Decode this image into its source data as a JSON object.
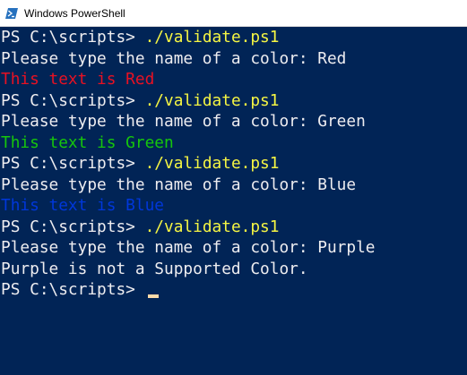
{
  "window": {
    "title": "Windows PowerShell",
    "app_icon": "powershell-icon"
  },
  "colors": {
    "background": "#012456",
    "default_text": "#eeedf0",
    "command": "#f5f543",
    "red": "#e81123",
    "green": "#16c60c",
    "blue": "#0037da",
    "cursor": "#fedba9"
  },
  "console": {
    "lines": [
      {
        "prompt": "PS C:\\scripts> ",
        "command": "./validate.ps1"
      },
      {
        "text": "Please type the name of a color: Red"
      },
      {
        "text": "This text is Red"
      },
      {
        "prompt": "PS C:\\scripts> ",
        "command": "./validate.ps1"
      },
      {
        "text": "Please type the name of a color: Green"
      },
      {
        "text": "This text is Green"
      },
      {
        "prompt": "PS C:\\scripts> ",
        "command": "./validate.ps1"
      },
      {
        "text": "Please type the name of a color: Blue"
      },
      {
        "text": "This text is Blue"
      },
      {
        "prompt": "PS C:\\scripts> ",
        "command": "./validate.ps1"
      },
      {
        "text": "Please type the name of a color: Purple"
      },
      {
        "text": "Purple is not a Supported Color."
      },
      {
        "prompt": "PS C:\\scripts> ",
        "command": ""
      }
    ]
  }
}
